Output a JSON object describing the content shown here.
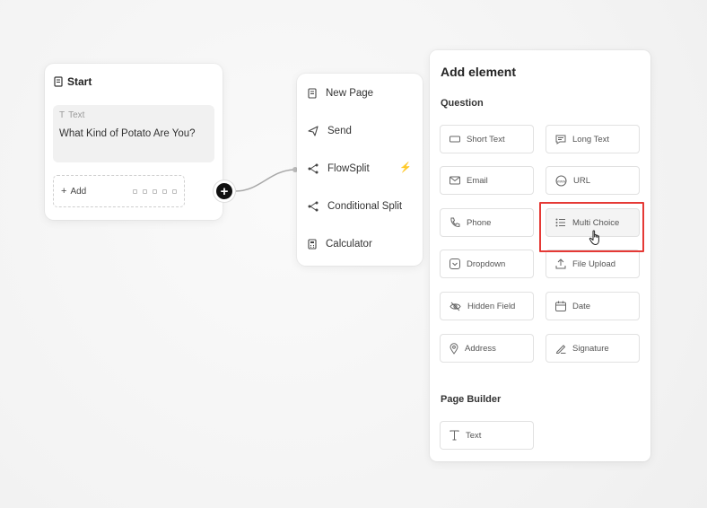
{
  "start_node": {
    "title": "Start",
    "text_block": {
      "type_label": "Text",
      "question": "What Kind of Potato Are You?"
    },
    "add_label": "Add"
  },
  "connector": {
    "plus_symbol": "+"
  },
  "menu": {
    "items": [
      {
        "label": "New Page",
        "icon": "page-icon"
      },
      {
        "label": "Send",
        "icon": "send-icon"
      },
      {
        "label": "FlowSplit",
        "icon": "split-icon"
      },
      {
        "label": "Conditional Split",
        "icon": "split-icon"
      },
      {
        "label": "Calculator",
        "icon": "calculator-icon"
      }
    ],
    "flowsplit_badge": "⚡"
  },
  "panel": {
    "title": "Add element",
    "question_section": "Question",
    "page_builder_section": "Page Builder",
    "question_items": [
      {
        "label": "Short Text",
        "icon": "short-text-icon"
      },
      {
        "label": "Long Text",
        "icon": "long-text-icon"
      },
      {
        "label": "Email",
        "icon": "email-icon"
      },
      {
        "label": "URL",
        "icon": "url-icon"
      },
      {
        "label": "Phone",
        "icon": "phone-icon"
      },
      {
        "label": "Multi Choice",
        "icon": "multi-choice-icon"
      },
      {
        "label": "Dropdown",
        "icon": "dropdown-icon"
      },
      {
        "label": "File Upload",
        "icon": "upload-icon"
      },
      {
        "label": "Hidden Field",
        "icon": "hidden-icon"
      },
      {
        "label": "Date",
        "icon": "calendar-icon"
      },
      {
        "label": "Address",
        "icon": "location-icon"
      },
      {
        "label": "Signature",
        "icon": "signature-icon"
      }
    ],
    "page_builder_items": [
      {
        "label": "Text",
        "icon": "text-icon"
      }
    ]
  },
  "colors": {
    "highlight": "#e53935",
    "accent_dark": "#111111"
  }
}
